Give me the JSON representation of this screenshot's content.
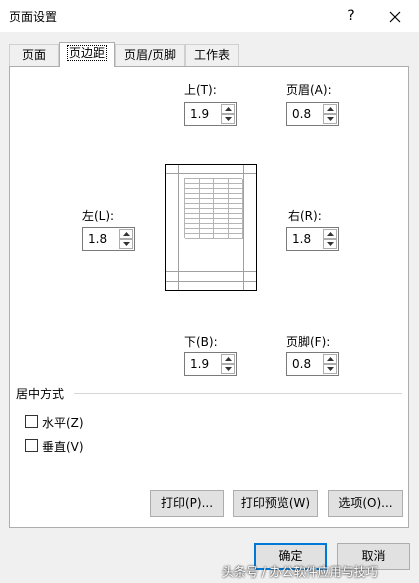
{
  "window": {
    "title": "页面设置",
    "help_label": "?"
  },
  "tabs": [
    {
      "label": "页面",
      "active": false
    },
    {
      "label": "页边距",
      "active": true
    },
    {
      "label": "页眉/页脚",
      "active": false
    },
    {
      "label": "工作表",
      "active": false
    }
  ],
  "margins": {
    "top": {
      "label": "上(T):",
      "value": "1.9"
    },
    "header": {
      "label": "页眉(A):",
      "value": "0.8"
    },
    "left": {
      "label": "左(L):",
      "value": "1.8"
    },
    "right": {
      "label": "右(R):",
      "value": "1.8"
    },
    "bottom": {
      "label": "下(B):",
      "value": "1.9"
    },
    "footer": {
      "label": "页脚(F):",
      "value": "0.8"
    }
  },
  "center": {
    "title": "居中方式",
    "horizontal": {
      "label": "水平(Z)",
      "checked": false
    },
    "vertical": {
      "label": "垂直(V)",
      "checked": false
    }
  },
  "panel_buttons": {
    "print": "打印(P)...",
    "preview": "打印预览(W)",
    "options": "选项(O)..."
  },
  "footer_buttons": {
    "ok": "确定",
    "cancel": "取消"
  },
  "watermark": "头条号 / 办公软件应用与技巧"
}
